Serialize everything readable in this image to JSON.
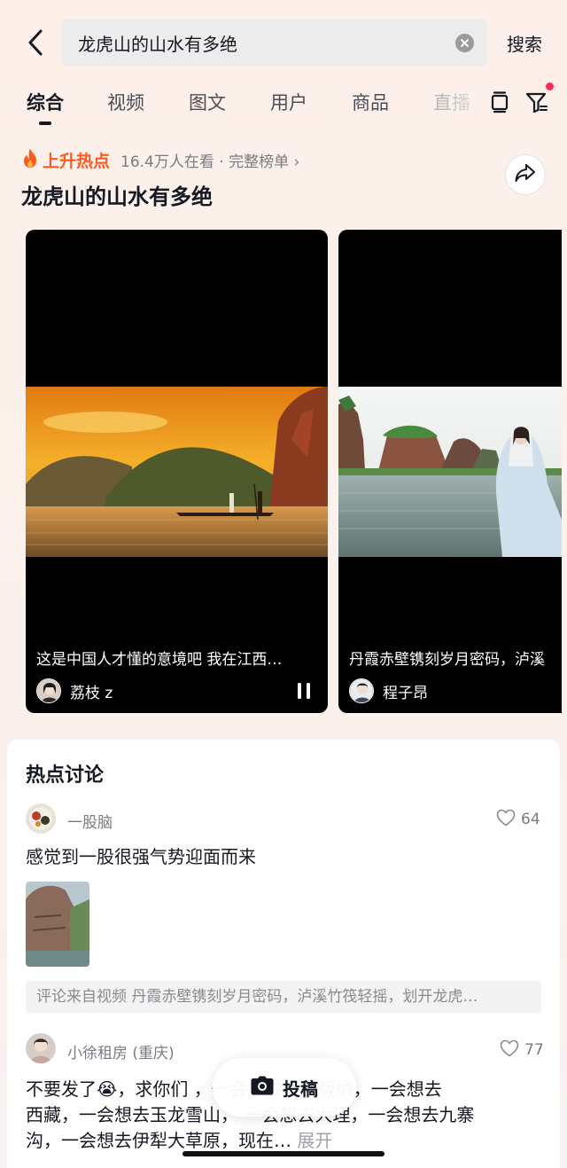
{
  "search": {
    "query": "龙虎山的山水有多绝",
    "submit_label": "搜索"
  },
  "tabs": [
    {
      "label": "综合",
      "active": true
    },
    {
      "label": "视频"
    },
    {
      "label": "图文"
    },
    {
      "label": "用户"
    },
    {
      "label": "商品"
    },
    {
      "label": "直播"
    }
  ],
  "hot_topic": {
    "badge_label": "上升热点",
    "views_text": "16.4万人在看 · 完整榜单 ›",
    "title": "龙虎山的山水有多绝"
  },
  "videos": [
    {
      "caption": "这是中国人才懂的意境吧 我在江西…",
      "author": "荔枝 z",
      "state": "playing"
    },
    {
      "caption": "丹霞赤壁镌刻岁月密码，泸溪",
      "author": "程子昂"
    }
  ],
  "discussion": {
    "title": "热点讨论",
    "comments": [
      {
        "user": "一股脑",
        "likes": "64",
        "text": "感觉到一股很强气势迎面而来",
        "source": "评论来自视频 丹霞赤壁镌刻岁月密码，泸溪竹筏轻摇，划开龙虎…"
      },
      {
        "user": "小徐租房 (重庆)",
        "likes": "77",
        "text_lines": [
          "不要发了😭，求你们 ，一会想去西双版纳，一会想去",
          "西藏，一会想去玉龙雪山， 一会想去大理，一会想去九寨",
          "沟，一会想去伊犁大草原，现在…"
        ],
        "expand_label": "展开"
      }
    ]
  },
  "post_button": {
    "label": "投稿"
  },
  "colors": {
    "accent_red": "#fe2c55",
    "hot_orange": "#fe5a1f",
    "text_primary": "#161823"
  }
}
